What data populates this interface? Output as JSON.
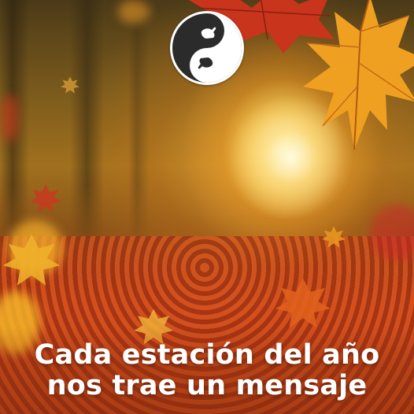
{
  "post": {
    "headline_line1": "Cada estación del año",
    "headline_line2": "nos trae un mensaje"
  },
  "logo": {
    "icon": "yin-yang-hands-icon",
    "colors": {
      "dark": "#2b2b2b",
      "light": "#ffffff"
    }
  },
  "colors": {
    "text": "#ffffff",
    "leaf_orange": "#e8761c",
    "leaf_red": "#c0301c",
    "sunlight": "#fff3c2"
  }
}
